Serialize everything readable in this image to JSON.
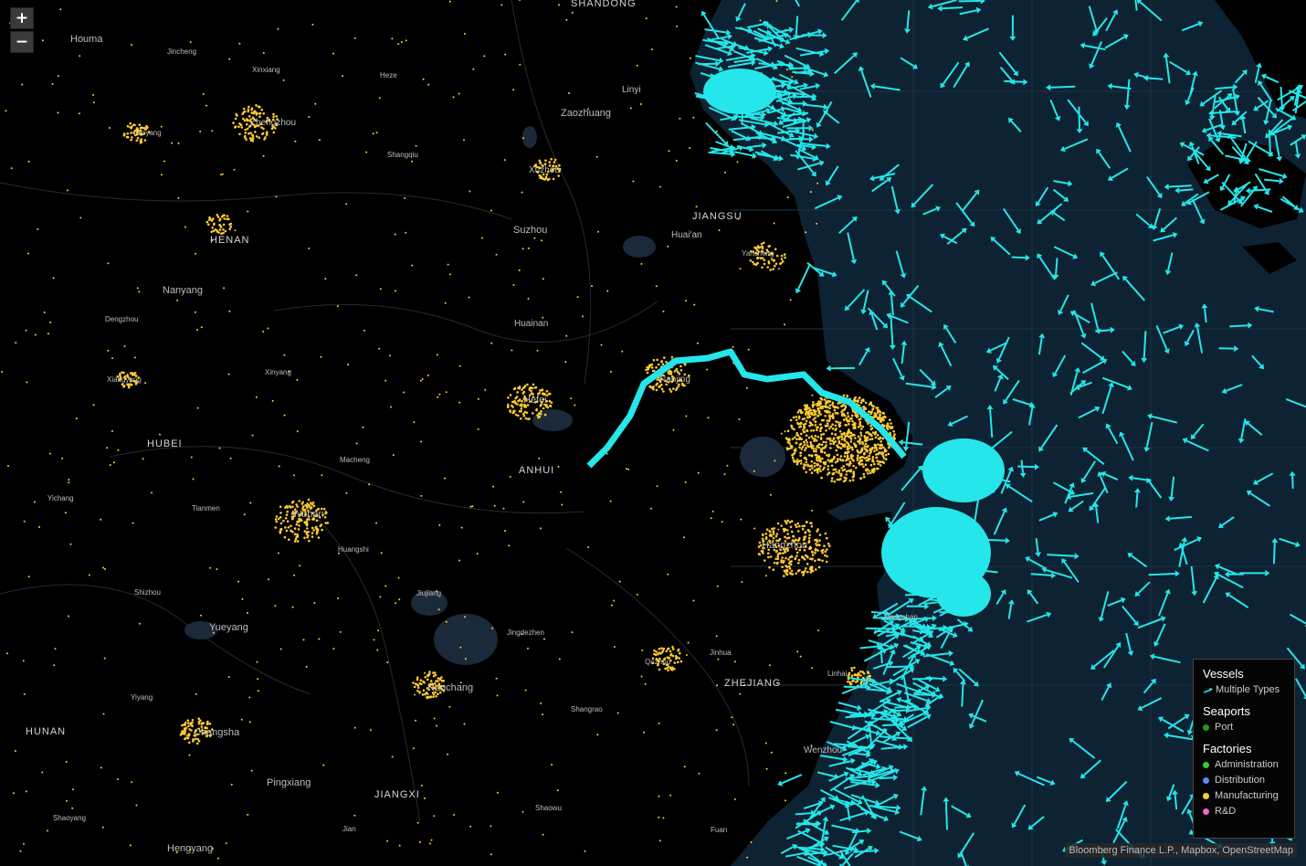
{
  "zoom": {
    "in_label": "+",
    "out_label": "−"
  },
  "colors": {
    "sea": "#0d2232",
    "land": "#000000",
    "water": "#1a2a3a",
    "vessel": "#25e6ea",
    "manufacturing": "#ffcc33",
    "port": "#1f9a1f",
    "administration": "#33cc33",
    "distribution": "#5a8ff0",
    "rnd": "#ee66cc"
  },
  "provinces": [
    "SHANDONG",
    "JIANGSU",
    "HENAN",
    "ANHUI",
    "HUBEI",
    "ZHEJIANG",
    "HUNAN",
    "JIANGXI"
  ],
  "cities": [
    "Houma",
    "Jincheng",
    "Xinxiang",
    "Heze",
    "Linyi",
    "Zaozhuang",
    "Zhengzhou",
    "Luoyang",
    "Shangqiu",
    "Xuzhou",
    "Suzhou",
    "Huai'an",
    "Yancheng",
    "Nanyang",
    "Dengzhou",
    "Huainan",
    "Xiangyang",
    "Xinyang",
    "Nanjing",
    "Hefei",
    "Macheng",
    "Yichang",
    "Tianmen",
    "Wuhan",
    "Huangshi",
    "Hangzhou",
    "Shizhou",
    "Jiujiang",
    "Yueyang",
    "Jingdezhen",
    "Jinhua",
    "Quzhou",
    "Linhai",
    "Xiangshan",
    "Yiyang",
    "Nanchang",
    "Shangrao",
    "Changsha",
    "Wenzhou",
    "Pingxiang",
    "Shaoyang",
    "Shaowu",
    "Jian",
    "Fuan",
    "Hengyang"
  ],
  "legend": {
    "vessels_title": "Vessels",
    "vessels_item": "Multiple Types",
    "seaports_title": "Seaports",
    "port_item": "Port",
    "factories_title": "Factories",
    "factory_items": [
      "Administration",
      "Distribution",
      "Manufacturing",
      "R&D"
    ]
  },
  "attribution": "Bloomberg Finance L.P., Mapbox, OpenStreetMap"
}
